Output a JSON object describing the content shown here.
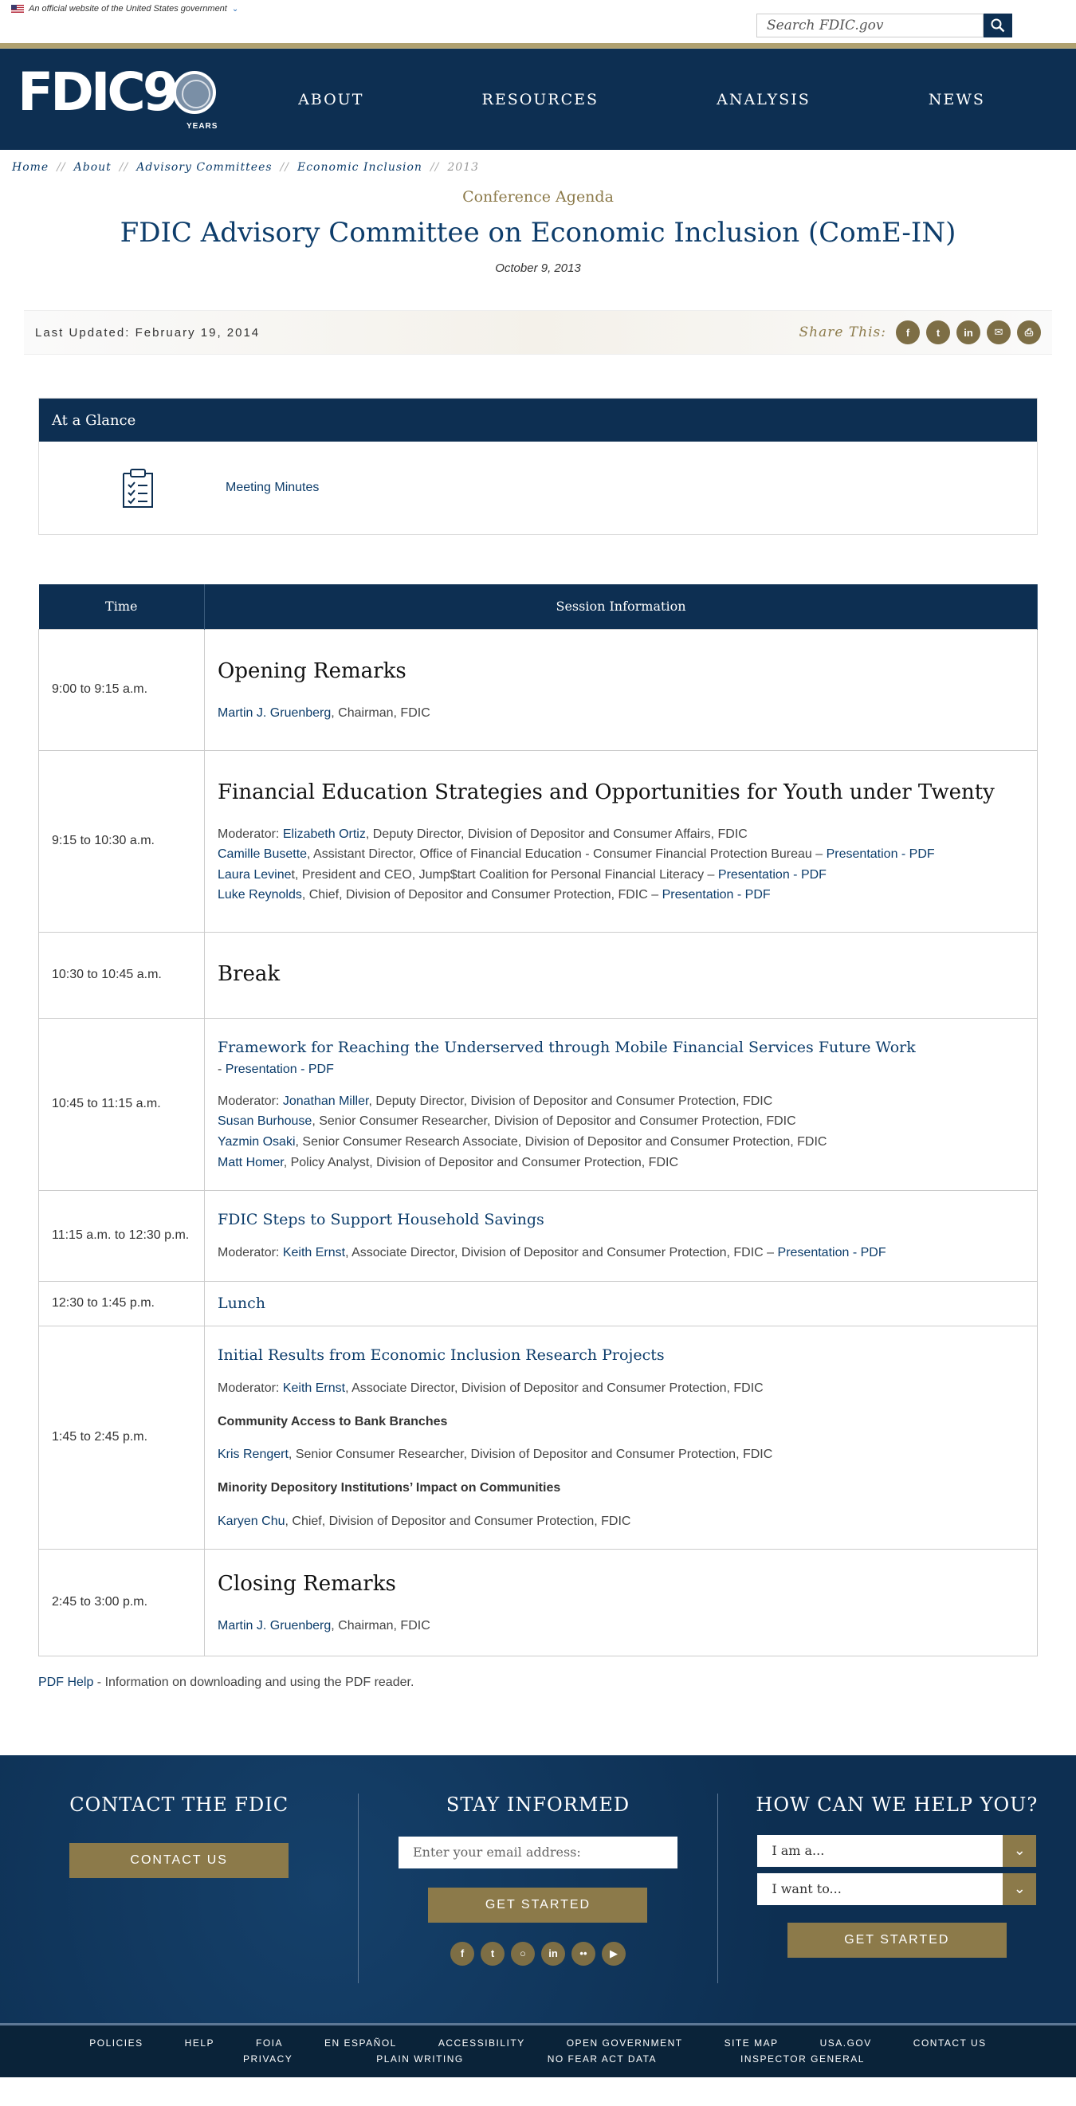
{
  "gov_banner": {
    "text": "An official website of the United States government"
  },
  "search": {
    "placeholder": "Search FDIC.gov"
  },
  "logo": {
    "fdic": "FDIC",
    "nine": "9",
    "years": "YEARS"
  },
  "nav": [
    "ABOUT",
    "RESOURCES",
    "ANALYSIS",
    "NEWS"
  ],
  "breadcrumb": [
    "Home",
    "About",
    "Advisory Committees",
    "Economic Inclusion",
    "2013"
  ],
  "page": {
    "kicker": "Conference Agenda",
    "title": "FDIC Advisory Committee on Economic Inclusion (ComE-IN)",
    "date": "October 9, 2013",
    "last_updated": "Last Updated: February 19, 2014",
    "share_label": "Share This:"
  },
  "glance": {
    "heading": "At a Glance",
    "link": "Meeting Minutes"
  },
  "agenda": {
    "headers": [
      "Time",
      "Session Information"
    ],
    "r1": {
      "time": "9:00 to 9:15 a.m.",
      "title": "Opening Remarks",
      "p1_link": "Martin J. Gruenberg",
      "p1_text": ", Chairman, FDIC"
    },
    "r2": {
      "time": "9:15 to 10:30 a.m.",
      "title": "Financial Education Strategies and Opportunities for Youth under Twenty",
      "mod_label": "Moderator: ",
      "mod_link": "Elizabeth Ortiz",
      "mod_text": ", Deputy Director, Division of Depositor and Consumer Affairs, FDIC",
      "a_link": "Camille Busette",
      "a_text": ", Assistant Director, Office of Financial Education - Consumer Financial Protection Bureau – ",
      "a_pdf": "Presentation - PDF",
      "b_link": "Laura Levine",
      "b_text": "t, President and CEO, Jump$tart Coalition for Personal Financial Literacy – ",
      "b_pdf": "Presentation - PDF",
      "c_link": "Luke Reynolds",
      "c_text": ", Chief, Division of Depositor and Consumer Protection, FDIC – ",
      "c_pdf": "Presentation - PDF"
    },
    "r3": {
      "time": "10:30 to 10:45 a.m.",
      "title": "Break"
    },
    "r4": {
      "time": "10:45 to 11:15 a.m.",
      "title": "Framework for Reaching the Underserved through Mobile Financial Services Future Work",
      "pdf_prefix": "- ",
      "pdf": "Presentation - PDF",
      "mod_label": "Moderator: ",
      "mod_link": "Jonathan Miller",
      "mod_text": ", Deputy Director, Division of Depositor and Consumer Protection, FDIC",
      "a_link": "Susan Burhouse",
      "a_text": ", Senior Consumer Researcher, Division of Depositor and Consumer Protection, FDIC",
      "b_link": "Yazmin Osaki",
      "b_text": ", Senior Consumer Research Associate, Division of Depositor and Consumer Protection, FDIC",
      "c_link": "Matt Homer",
      "c_text": ", Policy Analyst, Division of Depositor and Consumer Protection, FDIC"
    },
    "r5": {
      "time": "11:15 a.m. to 12:30 p.m.",
      "title": "FDIC Steps to Support Household Savings",
      "mod_label": "Moderator: ",
      "mod_link": "Keith Ernst",
      "mod_text": ", Associate Director, Division of Depositor and Consumer Protection, FDIC – ",
      "pdf": "Presentation - PDF"
    },
    "r6": {
      "time": "12:30 to 1:45 p.m.",
      "title": "Lunch"
    },
    "r7": {
      "time": "1:45 to 2:45 p.m.",
      "title": "Initial Results from Economic Inclusion Research Projects",
      "mod_label": "Moderator: ",
      "mod_link": "Keith Ernst",
      "mod_text": ", Associate Director, Division of Depositor and Consumer Protection, FDIC",
      "sub1": "Community Access to Bank Branches",
      "a_link": "Kris Rengert",
      "a_text": ", Senior Consumer Researcher, Division of Depositor and Consumer Protection, FDIC",
      "sub2": "Minority Depository Institutions’ Impact on Communities",
      "b_link": "Karyen Chu",
      "b_text": ", Chief, Division of Depositor and Consumer Protection, FDIC"
    },
    "r8": {
      "time": "2:45 to 3:00 p.m.",
      "title": "Closing Remarks",
      "p1_link": "Martin J. Gruenberg",
      "p1_text": ", Chairman, FDIC"
    }
  },
  "pdf_help": {
    "link": "PDF Help",
    "text": " - Information on downloading and using the PDF reader."
  },
  "footer": {
    "contact_title": "CONTACT THE FDIC",
    "contact_btn": "CONTACT US",
    "stay_title": "STAY INFORMED",
    "email_placeholder": "Enter your email address:",
    "stay_btn": "GET STARTED",
    "help_title": "HOW CAN WE HELP YOU?",
    "select1": "I am a...",
    "select2": "I want to...",
    "help_btn": "GET STARTED"
  },
  "bottom_links_row1": [
    "POLICIES",
    "HELP",
    "FOIA",
    "EN ESPAÑOL",
    "ACCESSIBILITY",
    "OPEN GOVERNMENT",
    "SITE MAP",
    "USA.GOV",
    "CONTACT US"
  ],
  "bottom_links_row2": [
    "PRIVACY",
    "PLAIN WRITING",
    "NO FEAR ACT DATA",
    "INSPECTOR GENERAL"
  ],
  "colors": {
    "navy": "#0d2f52",
    "gold": "#8c7a4a",
    "link": "#0d3d6b"
  },
  "icons": [
    "flag-icon",
    "search-icon",
    "facebook-icon",
    "twitter-icon",
    "linkedin-icon",
    "email-icon",
    "print-icon",
    "checklist-icon",
    "instagram-icon",
    "flickr-icon",
    "youtube-icon",
    "chevron-down-icon"
  ]
}
